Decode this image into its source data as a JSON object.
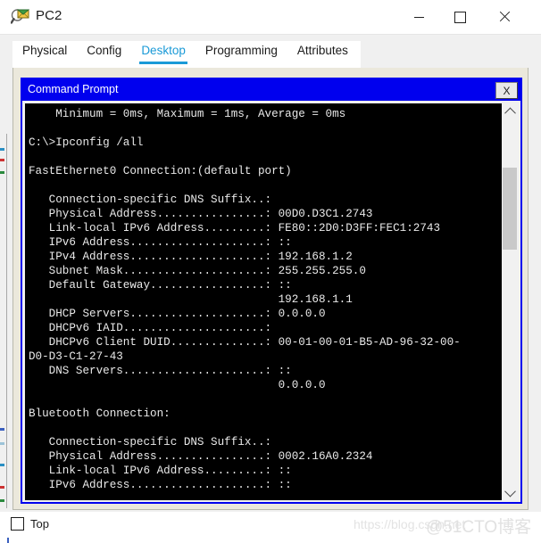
{
  "window": {
    "title": "PC2",
    "icon": "packet-tracer-icon",
    "controls": {
      "minimize": "minimize-icon",
      "maximize": "maximize-icon",
      "close": "close-icon"
    }
  },
  "tabs": [
    {
      "label": "Physical",
      "active": false
    },
    {
      "label": "Config",
      "active": false
    },
    {
      "label": "Desktop",
      "active": true
    },
    {
      "label": "Programming",
      "active": false
    },
    {
      "label": "Attributes",
      "active": false
    }
  ],
  "command_prompt": {
    "title": "Command Prompt",
    "close_label": "X",
    "scrollbar": {
      "up_icon": "chevron-up-icon",
      "down_icon": "chevron-down-icon"
    },
    "lines": [
      "    Minimum = 0ms, Maximum = 1ms, Average = 0ms",
      "",
      "C:\\>Ipconfig /all",
      "",
      "FastEthernet0 Connection:(default port)",
      "",
      "   Connection-specific DNS Suffix..:",
      "   Physical Address................: 00D0.D3C1.2743",
      "   Link-local IPv6 Address.........: FE80::2D0:D3FF:FEC1:2743",
      "   IPv6 Address....................: ::",
      "   IPv4 Address....................: 192.168.1.2",
      "   Subnet Mask.....................: 255.255.255.0",
      "   Default Gateway.................: ::",
      "                                     192.168.1.1",
      "   DHCP Servers....................: 0.0.0.0",
      "   DHCPv6 IAID.....................:",
      "   DHCPv6 Client DUID..............: 00-01-00-01-B5-AD-96-32-00-",
      "D0-D3-C1-27-43",
      "   DNS Servers.....................: ::",
      "                                     0.0.0.0",
      "",
      "Bluetooth Connection:",
      "",
      "   Connection-specific DNS Suffix..:",
      "   Physical Address................: 0002.16A0.2324",
      "   Link-local IPv6 Address.........: ::",
      "   IPv6 Address....................: ::"
    ]
  },
  "bottom": {
    "top_checkbox_label": "Top",
    "top_checkbox_checked": false
  },
  "watermarks": {
    "primary": "https://blog.csdn.net",
    "secondary": "@51CTO博客"
  },
  "colors": {
    "accent": "#1a9ad7",
    "cmd_title_bg": "#0000ee",
    "terminal_bg": "#000000",
    "terminal_fg": "#e9e9e9",
    "panel_bg": "#ebe8dc"
  }
}
